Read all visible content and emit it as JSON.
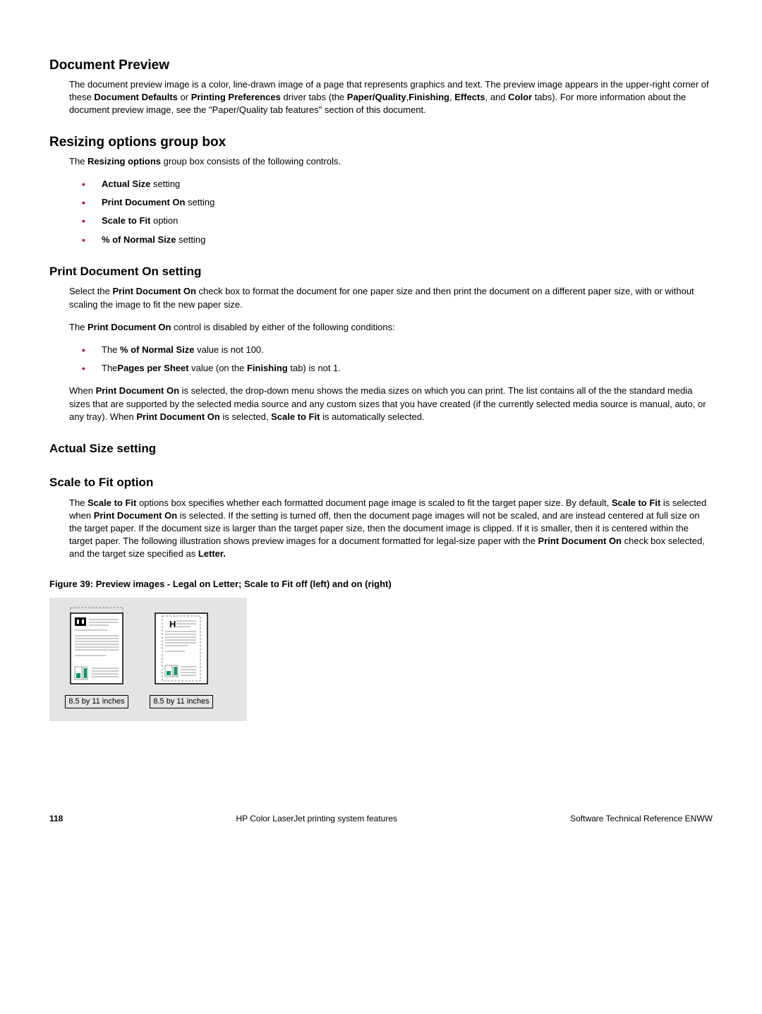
{
  "section1": {
    "title": "Document Preview",
    "para": "The document preview image is a color, line-drawn image of a page that represents graphics and text. The preview image appears in the upper-right corner of these Document Defaults or Printing Preferences driver tabs (the Paper/Quality,Finishing, Effects, and Color tabs). For more information about the document preview image, see the \"Paper/Quality tab features\" section of this document."
  },
  "section2": {
    "title": "Resizing options group box",
    "intro_pre": "The ",
    "intro_bold": "Resizing options",
    "intro_post": " group box consists of the following controls.",
    "b1": "Actual Size",
    "b1_post": "  setting",
    "b2": "Print Document On",
    "b2_post": " setting",
    "b3": "Scale to Fit",
    "b3_post": " option",
    "b4": "% of Normal Size",
    "b4_post": " setting"
  },
  "section3": {
    "title": "Print Document On setting",
    "p1_a": "Select the ",
    "p1_b": "Print Document On",
    "p1_c": " check box to format the document for one paper size and then print the document on a different paper size, with or without scaling the image to fit the new paper size.",
    "p2_a": "The ",
    "p2_b": "Print Document On",
    "p2_c": " control is disabled by either of the following conditions:",
    "b1_a": "The ",
    "b1_b": "% of Normal Size",
    "b1_c": " value is not 100.",
    "b2_a": "The",
    "b2_b": "Pages per Sheet",
    "b2_c": " value (on the ",
    "b2_d": "Finishing",
    "b2_e": " tab) is not 1.",
    "p3_a": "When ",
    "p3_b": "Print Document On",
    "p3_c": " is selected, the drop-down menu shows the media sizes on which you can print. The list contains all of the the standard media sizes that are supported by the selected media source and any custom sizes that you have created (if the currently selected media source is manual, auto, or any tray). When ",
    "p3_d": "Print Document On",
    "p3_e": " is selected, ",
    "p3_f": "Scale to Fit",
    "p3_g": " is automatically selected."
  },
  "section4": {
    "title": "Actual Size setting"
  },
  "section5": {
    "title": "Scale to Fit option",
    "p1_a": "The ",
    "p1_b": "Scale to Fit",
    "p1_c": "  options box specifies whether each formatted document page image is scaled to fit the target paper size. By default, ",
    "p1_d": "Scale to Fit",
    "p1_e": " is selected when ",
    "p1_f": "Print Document On",
    "p1_g": " is selected. If the setting is turned off, then the document page images will not be scaled, and are instead centered at full size on the target paper. If the document size is larger than the target paper size, then the document image is clipped. If it is smaller, then it is centered within the target paper. The following illustration shows preview images for a document formatted for legal-size paper with the ",
    "p1_h": "Print Document On",
    "p1_i": " check box selected, and the target size specified as ",
    "p1_j": "Letter."
  },
  "figure": {
    "caption": "Figure 39: Preview images - Legal on Letter; Scale to Fit off (left) and on (right)",
    "label1": "8.5 by 11 inches",
    "label2": "8.5 by 11 inches"
  },
  "footer": {
    "page": "118",
    "center": "HP Color LaserJet printing system features",
    "right": "Software Technical Reference ENWW"
  }
}
